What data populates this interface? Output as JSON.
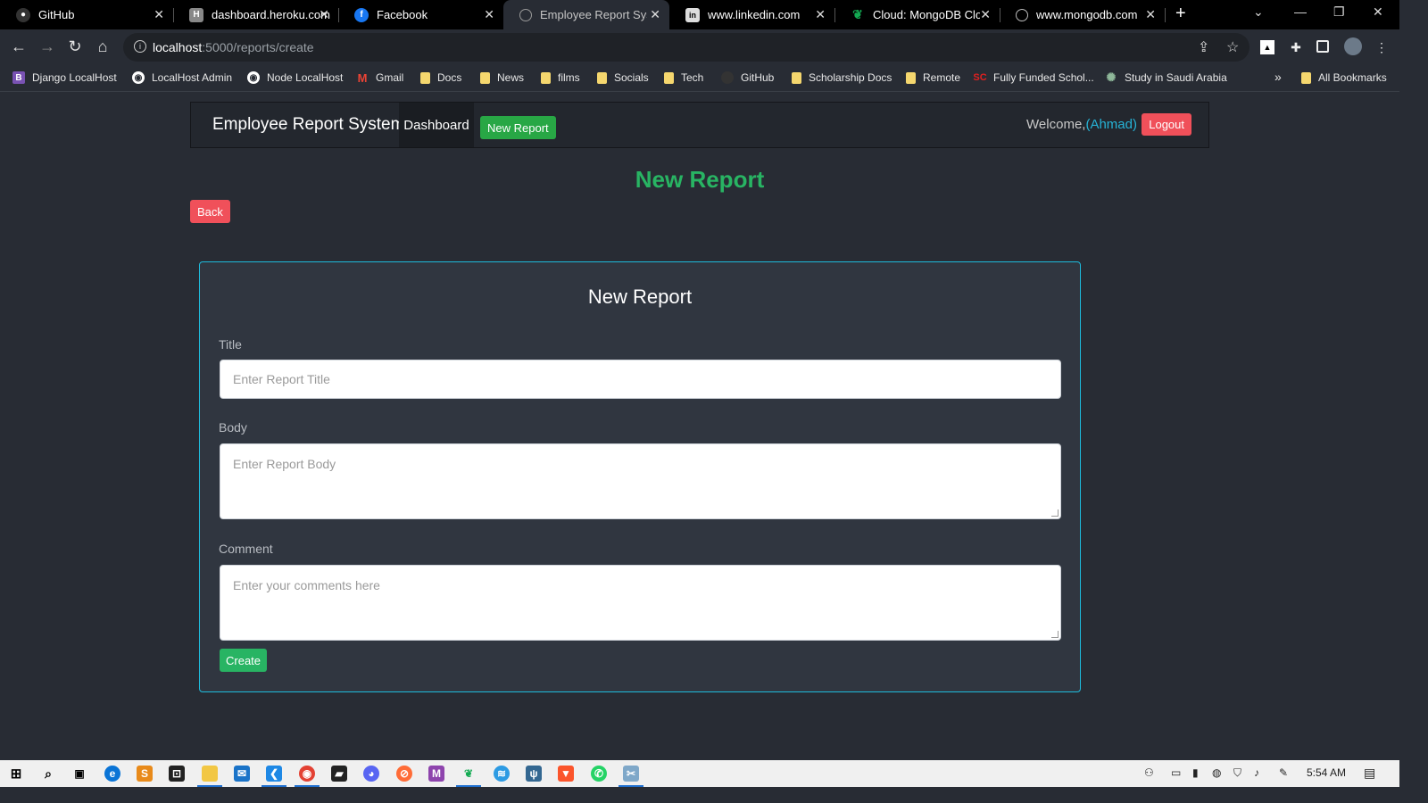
{
  "browser": {
    "tabs": [
      {
        "title": "GitHub",
        "icon": "github-icon"
      },
      {
        "title": "dashboard.heroku.com",
        "icon": "heroku-icon"
      },
      {
        "title": "Facebook",
        "icon": "facebook-icon"
      },
      {
        "title": "Employee Report Syste",
        "icon": "globe-icon",
        "active": true
      },
      {
        "title": "www.linkedin.com",
        "icon": "linkedin-icon"
      },
      {
        "title": "Cloud: MongoDB Clou",
        "icon": "mongodb-icon"
      },
      {
        "title": "www.mongodb.com",
        "icon": "globe-icon"
      }
    ],
    "url_host": "localhost",
    "url_rest": ":5000/reports/create",
    "bookmarks": [
      {
        "label": "Django LocalHost",
        "icon": "bootstrap-icon"
      },
      {
        "label": "LocalHost Admin",
        "icon": "globe-icon"
      },
      {
        "label": "Node LocalHost",
        "icon": "globe-icon"
      },
      {
        "label": "Gmail",
        "icon": "gmail-icon"
      },
      {
        "label": "Docs",
        "icon": "folder-icon"
      },
      {
        "label": "News",
        "icon": "folder-icon"
      },
      {
        "label": "films",
        "icon": "folder-icon"
      },
      {
        "label": "Socials",
        "icon": "folder-icon"
      },
      {
        "label": "Tech",
        "icon": "folder-icon"
      },
      {
        "label": "GitHub",
        "icon": "github-icon"
      },
      {
        "label": "Scholarship Docs",
        "icon": "folder-icon"
      },
      {
        "label": "Remote",
        "icon": "folder-icon"
      },
      {
        "label": "Fully Funded Schol...",
        "icon": "sc-icon"
      },
      {
        "label": "Study in Saudi Arabia",
        "icon": "sun-icon"
      }
    ],
    "bookmarks_overflow": "»",
    "all_bookmarks": "All Bookmarks"
  },
  "app": {
    "brand": "Employee Report System",
    "nav_dashboard": "Dashboard",
    "nav_new_report": "New Report",
    "welcome_prefix": "Welcome,",
    "welcome_user": "(Ahmad)",
    "logout": "Logout",
    "page_title": "New Report",
    "back": "Back",
    "form": {
      "title": "New Report",
      "title_label": "Title",
      "title_placeholder": "Enter Report Title",
      "body_label": "Body",
      "body_placeholder": "Enter Report Body",
      "comment_label": "Comment",
      "comment_placeholder": "Enter your comments here",
      "submit": "Create"
    }
  },
  "taskbar": {
    "time": "5:54 AM"
  },
  "colors": {
    "page_bg": "#282c34",
    "accent_green": "#28b463",
    "danger_red": "#f0505a",
    "card_border": "#1ebbdc",
    "username": "#26b3d6"
  }
}
